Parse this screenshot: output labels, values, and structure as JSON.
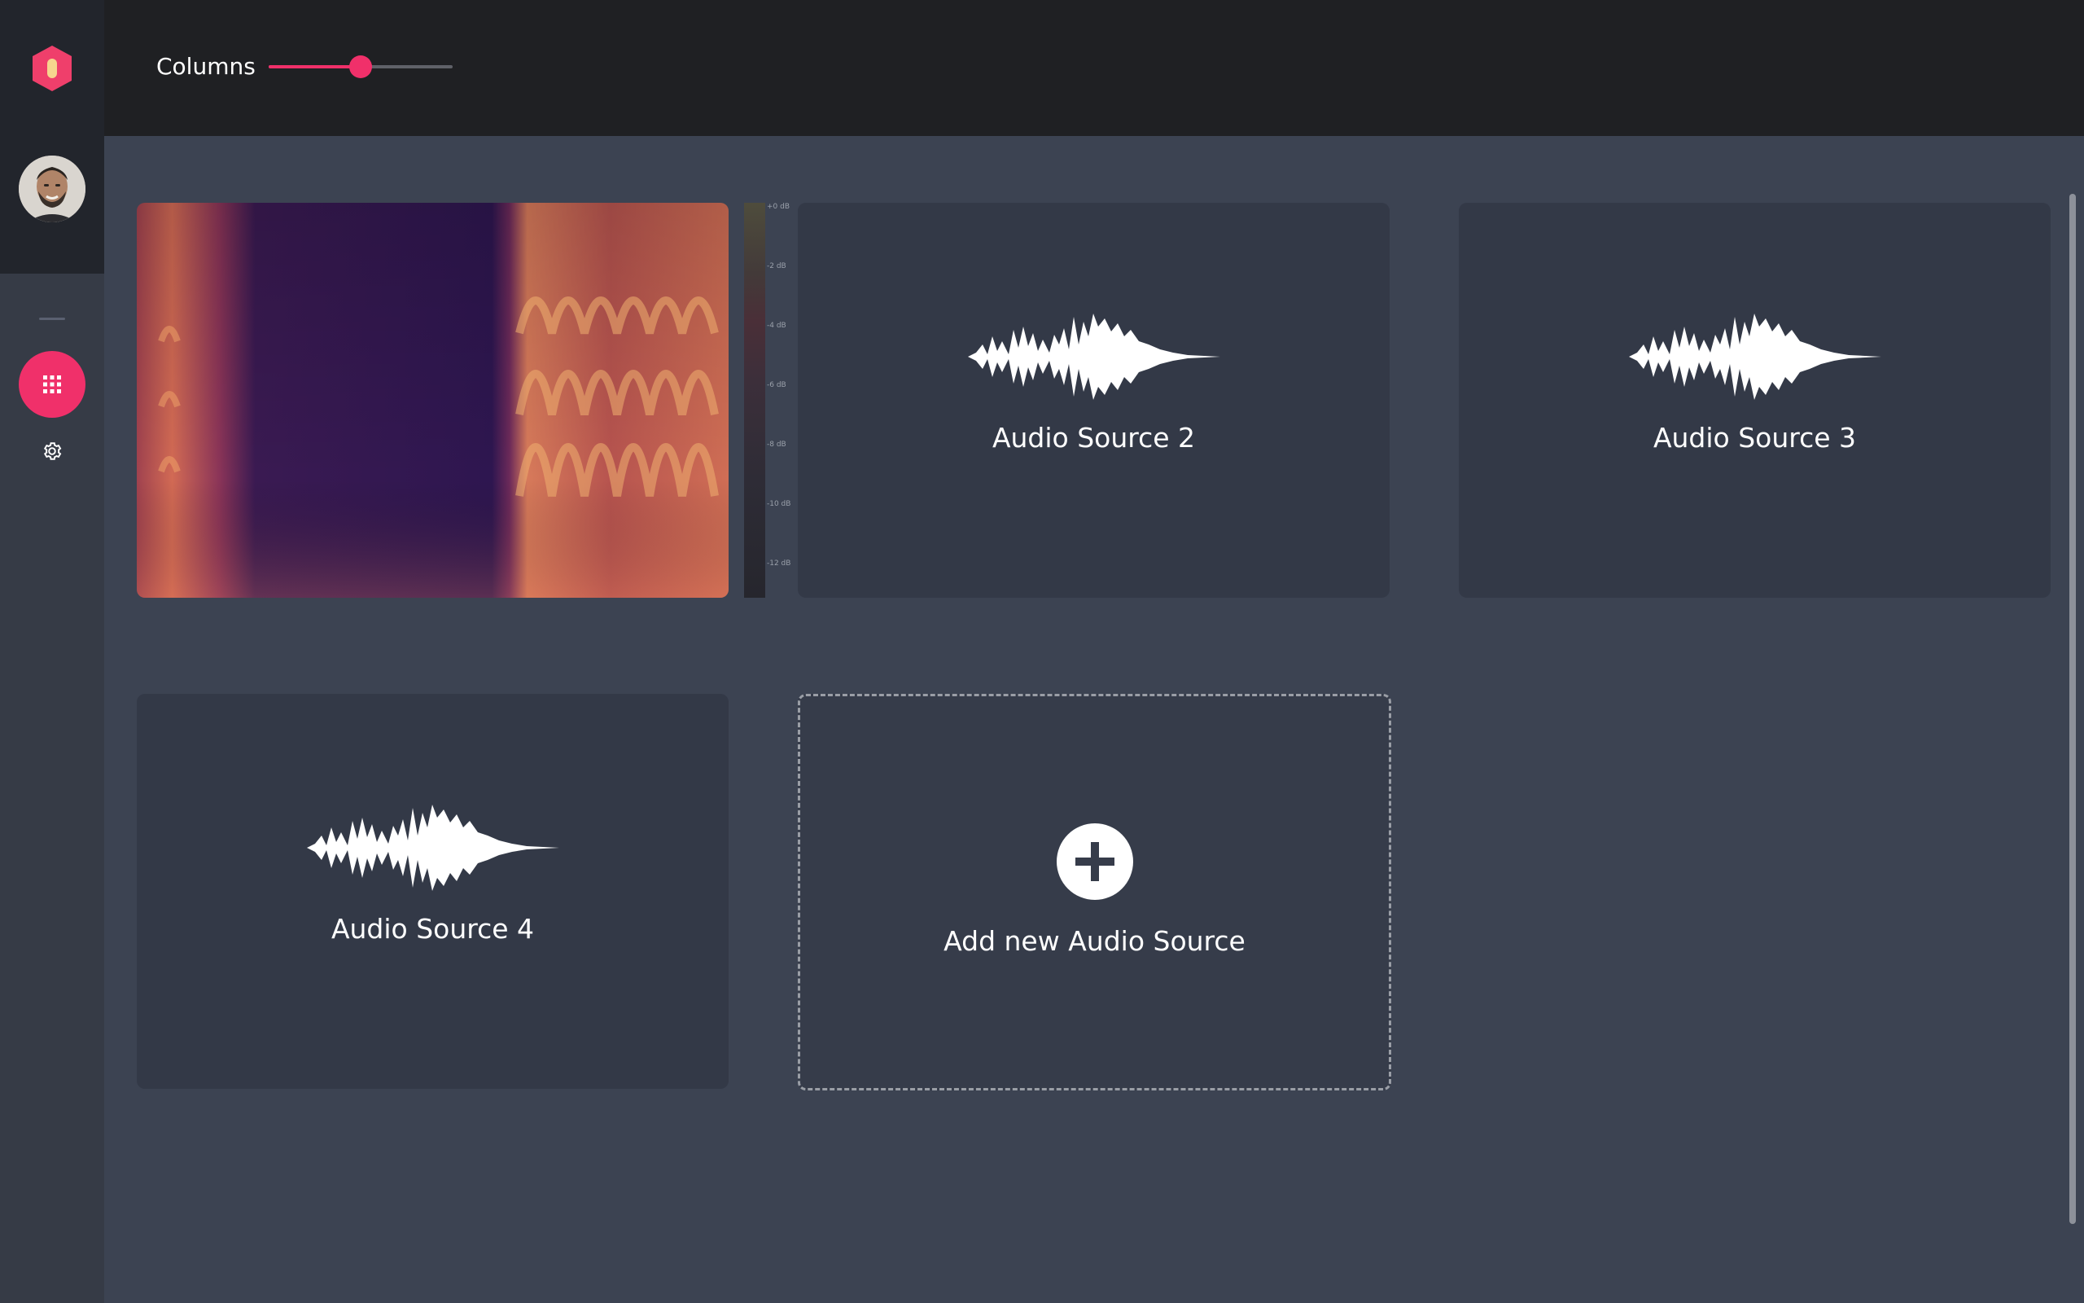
{
  "header": {
    "columns_label": "Columns",
    "columns_slider_value": 0.5
  },
  "sidebar": {
    "logo": "app-logo-hexagon",
    "avatar": "user-avatar",
    "nav_items": [
      {
        "icon": "grid-icon",
        "active": true
      },
      {
        "icon": "gear-icon",
        "active": false
      }
    ]
  },
  "colorbar": {
    "ticks": [
      "+0 dB",
      "-2 dB",
      "-4 dB",
      "-6 dB",
      "-8 dB",
      "-10 dB",
      "-12 dB"
    ]
  },
  "cards": [
    {
      "title": "Audio Source 2"
    },
    {
      "title": "Audio Source 3"
    },
    {
      "title": "Audio Source 4"
    }
  ],
  "add_card": {
    "label": "Add new Audio Source"
  },
  "colors": {
    "accent": "#f0306a",
    "header_bg": "#1f2023",
    "main_bg": "#3c4352",
    "card_bg": "#333947"
  }
}
